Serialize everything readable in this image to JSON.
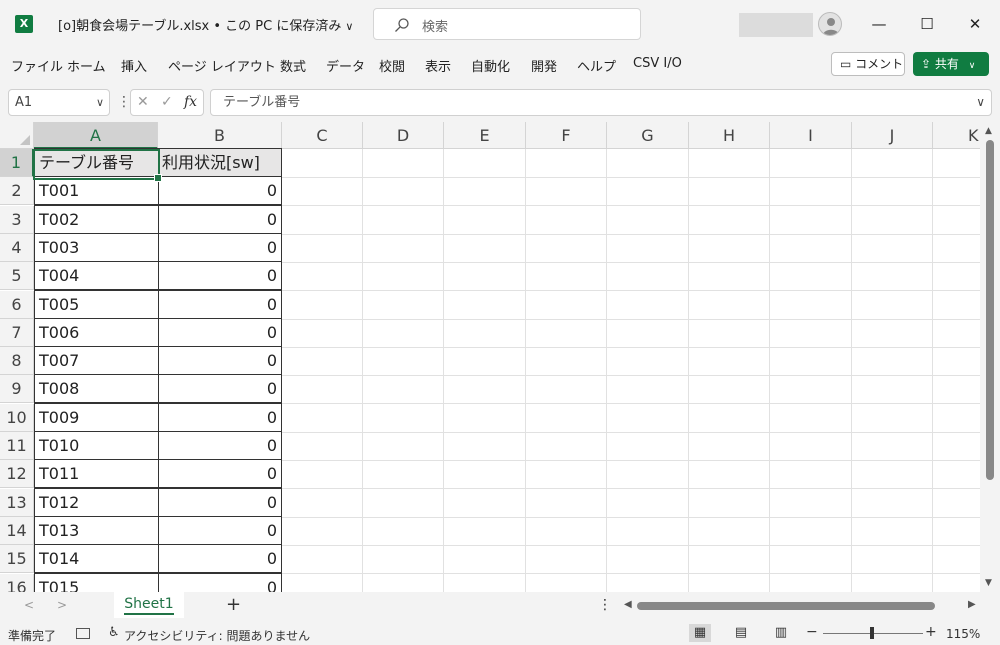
{
  "window": {
    "app_icon_letter": "X",
    "file_title": "[o]朝食会場テーブル.xlsx • この PC に保存済み",
    "title_chevron": "∨",
    "search_placeholder": "検索",
    "minimize": "—",
    "maximize": "☐",
    "close": "✕"
  },
  "menu": {
    "items": [
      "ファイル",
      "ホーム",
      "挿入",
      "ページ レイアウト",
      "数式",
      "データ",
      "校閲",
      "表示",
      "自動化",
      "開発",
      "ヘルプ",
      "CSV I/O"
    ],
    "comment_label": "コメント",
    "share_label": "共有"
  },
  "formula_bar": {
    "name_box": "A1",
    "formula": "テーブル番号",
    "cancel_glyph": "✕",
    "enter_glyph": "✓",
    "fx_glyph": "fx"
  },
  "grid": {
    "columns": [
      "A",
      "B",
      "C",
      "D",
      "E",
      "F",
      "G",
      "H",
      "I",
      "J",
      "K"
    ],
    "row_numbers": [
      "1",
      "2",
      "3",
      "4",
      "5",
      "6",
      "7",
      "8",
      "9",
      "10",
      "11",
      "12",
      "13",
      "14",
      "15",
      "16"
    ],
    "header_row": [
      "テーブル番号",
      "利用状況[sw]"
    ],
    "rows": [
      [
        "T001",
        "0"
      ],
      [
        "T002",
        "0"
      ],
      [
        "T003",
        "0"
      ],
      [
        "T004",
        "0"
      ],
      [
        "T005",
        "0"
      ],
      [
        "T006",
        "0"
      ],
      [
        "T007",
        "0"
      ],
      [
        "T008",
        "0"
      ],
      [
        "T009",
        "0"
      ],
      [
        "T010",
        "0"
      ],
      [
        "T011",
        "0"
      ],
      [
        "T012",
        "0"
      ],
      [
        "T013",
        "0"
      ],
      [
        "T014",
        "0"
      ],
      [
        "T015",
        "0"
      ]
    ],
    "selected_cell": "A1"
  },
  "sheets": {
    "active": "Sheet1",
    "add_label": "+"
  },
  "status": {
    "ready": "準備完了",
    "accessibility": "アクセシビリティ: 問題ありません",
    "zoom": "115%",
    "zoom_minus": "−",
    "zoom_plus": "+"
  },
  "colors": {
    "brand_green": "#107c41",
    "selection_green": "#217346",
    "header_fill": "#e7e6e6"
  }
}
